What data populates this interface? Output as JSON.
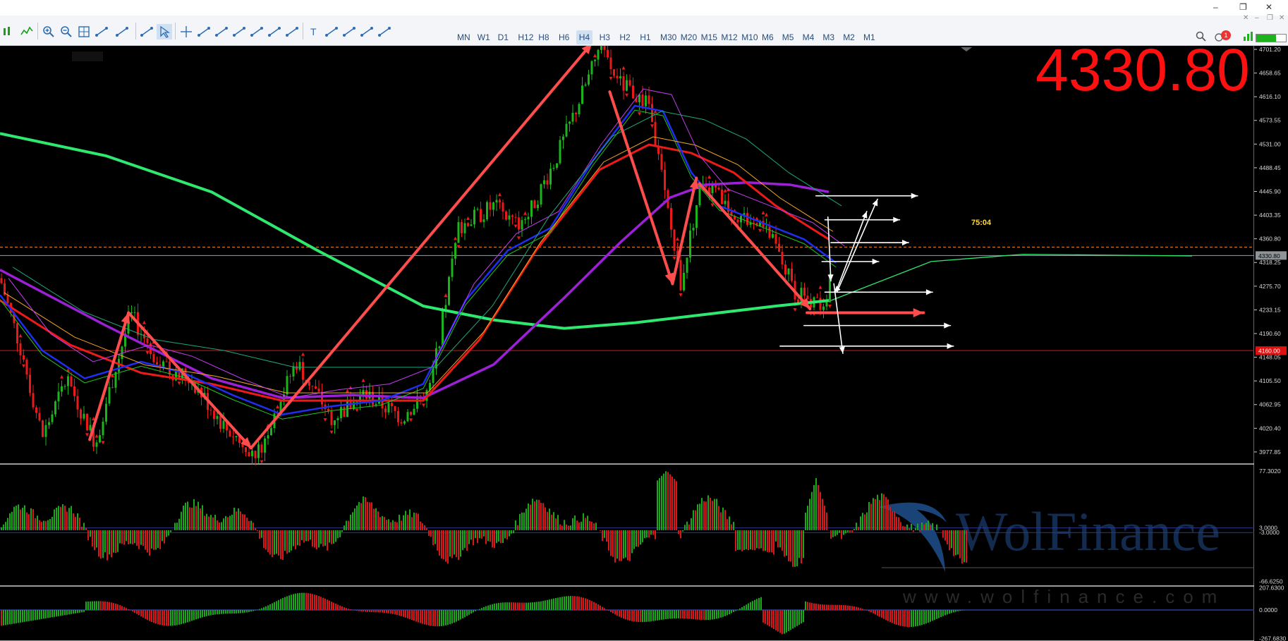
{
  "window": {
    "controls": [
      "–",
      "❐",
      "✕"
    ],
    "sub_controls": [
      "✕",
      "–",
      "❐",
      "✕"
    ]
  },
  "toolbar": {
    "timeframes": [
      "MN",
      "W1",
      "D1",
      "H12",
      "H8",
      "H6",
      "H4",
      "H3",
      "H2",
      "H1",
      "M30",
      "M20",
      "M15",
      "M12",
      "M10",
      "M6",
      "M5",
      "M4",
      "M3",
      "M2",
      "M1"
    ],
    "active_timeframe": "H4",
    "left_tools": [
      "bar-chart-icon",
      "line-chart-icon",
      "zoom-in-icon",
      "zoom-out-icon",
      "grid-icon",
      "autoscroll-icon",
      "chart-shift-icon",
      "screenshot-icon",
      "cursor-icon",
      "crosshair-icon",
      "vertical-line-icon",
      "horizontal-line-icon",
      "trendline-icon",
      "ray-icon",
      "channel-icon",
      "fibonacci-icon",
      "text-icon",
      "elliott-icon",
      "gann-icon",
      "shapes-icon",
      "more-shapes-icon"
    ],
    "right_tools": [
      "search-icon",
      "notifications-icon",
      "signal-icon"
    ],
    "notification_count": "1"
  },
  "colors": {
    "bull": "#1db31d",
    "bear": "#e81a1a",
    "ma_fast_blue": "#1f2ef0",
    "ma_red": "#ee1a1a",
    "ma_purple": "#9b20d6",
    "ma_green": "#2ee86f",
    "ma_orange": "#f5a623",
    "hist_bull": "#18a818",
    "hist_bear": "#d71818",
    "annotation": "#ff4d4d",
    "big_price": "#ff1010"
  },
  "price_display": "4330.80",
  "countdown": "75:04",
  "watermark": {
    "brand": "WolFinance",
    "url": "www.wolfinance.com"
  },
  "chart_data": [
    {
      "type": "candlestick",
      "title": "",
      "y_axis_ticks": [
        "4701.20",
        "4658.65",
        "4616.10",
        "4573.55",
        "4531.00",
        "4488.45",
        "4445.90",
        "4403.35",
        "4360.80",
        "4318.25",
        "4275.70",
        "4233.15",
        "4190.60",
        "4148.05",
        "4105.50",
        "4062.95",
        "4020.40",
        "3977.85"
      ],
      "ylim": [
        3960,
        4705
      ],
      "current_price_label": "4330.80",
      "support_level_label": "4160.00",
      "dashed_reference": 4346,
      "price_path_pivots": [
        {
          "x": 0,
          "y": 4290
        },
        {
          "x": 30,
          "y": 4160
        },
        {
          "x": 60,
          "y": 4005
        },
        {
          "x": 95,
          "y": 4110
        },
        {
          "x": 135,
          "y": 3995
        },
        {
          "x": 185,
          "y": 4225
        },
        {
          "x": 230,
          "y": 4130
        },
        {
          "x": 270,
          "y": 4110
        },
        {
          "x": 320,
          "y": 4020
        },
        {
          "x": 365,
          "y": 3975
        },
        {
          "x": 420,
          "y": 4140
        },
        {
          "x": 470,
          "y": 4040
        },
        {
          "x": 520,
          "y": 4080
        },
        {
          "x": 570,
          "y": 4040
        },
        {
          "x": 610,
          "y": 4090
        },
        {
          "x": 650,
          "y": 4380
        },
        {
          "x": 700,
          "y": 4420
        },
        {
          "x": 740,
          "y": 4380
        },
        {
          "x": 790,
          "y": 4510
        },
        {
          "x": 850,
          "y": 4700
        },
        {
          "x": 880,
          "y": 4640
        },
        {
          "x": 920,
          "y": 4600
        },
        {
          "x": 965,
          "y": 4280
        },
        {
          "x": 995,
          "y": 4470
        },
        {
          "x": 1040,
          "y": 4410
        },
        {
          "x": 1090,
          "y": 4370
        },
        {
          "x": 1130,
          "y": 4260
        },
        {
          "x": 1170,
          "y": 4235
        },
        {
          "x": 1178,
          "y": 4330
        }
      ],
      "moving_averages": [
        {
          "name": "",
          "color": "ma_green",
          "width": 4,
          "points": [
            [
              0,
              4550
            ],
            [
              150,
              4510
            ],
            [
              300,
              4445
            ],
            [
              450,
              4340
            ],
            [
              600,
              4240
            ],
            [
              700,
              4215
            ],
            [
              800,
              4200
            ],
            [
              900,
              4210
            ],
            [
              1000,
              4225
            ],
            [
              1100,
              4240
            ],
            [
              1175,
              4250
            ]
          ]
        },
        {
          "name": "",
          "color": "ma_purple",
          "width": 3.5,
          "points": [
            [
              0,
              4305
            ],
            [
              150,
              4205
            ],
            [
              300,
              4110
            ],
            [
              400,
              4075
            ],
            [
              500,
              4080
            ],
            [
              600,
              4075
            ],
            [
              700,
              4135
            ],
            [
              800,
              4255
            ],
            [
              880,
              4355
            ],
            [
              950,
              4435
            ],
            [
              1000,
              4458
            ],
            [
              1060,
              4462
            ],
            [
              1120,
              4458
            ],
            [
              1175,
              4445
            ]
          ]
        },
        {
          "name": "",
          "color": "ma_red",
          "width": 3,
          "points": [
            [
              0,
              4250
            ],
            [
              100,
              4170
            ],
            [
              200,
              4120
            ],
            [
              300,
              4100
            ],
            [
              400,
              4070
            ],
            [
              500,
              4070
            ],
            [
              600,
              4070
            ],
            [
              680,
              4180
            ],
            [
              760,
              4340
            ],
            [
              850,
              4485
            ],
            [
              920,
              4530
            ],
            [
              980,
              4515
            ],
            [
              1040,
              4480
            ],
            [
              1100,
              4420
            ],
            [
              1175,
              4360
            ]
          ]
        },
        {
          "name": "",
          "color": "ma_fast_blue",
          "width": 2.5,
          "points": [
            [
              0,
              4260
            ],
            [
              60,
              4160
            ],
            [
              120,
              4110
            ],
            [
              200,
              4140
            ],
            [
              260,
              4120
            ],
            [
              330,
              4080
            ],
            [
              400,
              4045
            ],
            [
              470,
              4060
            ],
            [
              540,
              4070
            ],
            [
              600,
              4100
            ],
            [
              660,
              4250
            ],
            [
              720,
              4340
            ],
            [
              780,
              4380
            ],
            [
              840,
              4500
            ],
            [
              900,
              4600
            ],
            [
              940,
              4590
            ],
            [
              980,
              4480
            ],
            [
              1020,
              4420
            ],
            [
              1080,
              4390
            ],
            [
              1140,
              4360
            ],
            [
              1185,
              4318
            ]
          ]
        }
      ],
      "annotations_arrows": [
        {
          "from": [
            150,
            4000
          ],
          "to": [
            215,
            4228
          ],
          "color": "annotation"
        },
        {
          "from": [
            215,
            4228
          ],
          "to": [
            420,
            3985
          ],
          "color": "annotation"
        },
        {
          "from": [
            420,
            3985
          ],
          "to": [
            990,
            4712
          ],
          "color": "annotation"
        },
        {
          "from": [
            1020,
            4625
          ],
          "to": [
            1125,
            4280
          ],
          "color": "annotation"
        },
        {
          "from": [
            1125,
            4280
          ],
          "to": [
            1165,
            4470
          ],
          "color": "annotation"
        },
        {
          "from": [
            1170,
            4460
          ],
          "to": [
            1355,
            4235
          ],
          "color": "annotation"
        },
        {
          "from": [
            1350,
            4228
          ],
          "to": [
            1545,
            4228
          ],
          "color": "annotation"
        }
      ],
      "projection_arrows": [
        {
          "from": [
            1365,
            4438
          ],
          "to": [
            1535,
            4438
          ]
        },
        {
          "from": [
            1380,
            4395
          ],
          "to": [
            1505,
            4395
          ]
        },
        {
          "from": [
            1390,
            4354
          ],
          "to": [
            1520,
            4354
          ]
        },
        {
          "from": [
            1375,
            4320
          ],
          "to": [
            1470,
            4320
          ]
        },
        {
          "from": [
            1380,
            4265
          ],
          "to": [
            1560,
            4265
          ]
        },
        {
          "from": [
            1345,
            4205
          ],
          "to": [
            1590,
            4205
          ]
        },
        {
          "from": [
            1305,
            4168
          ],
          "to": [
            1595,
            4168
          ]
        },
        {
          "from": [
            1400,
            4270
          ],
          "to": [
            1450,
            4410
          ]
        },
        {
          "from": [
            1400,
            4270
          ],
          "to": [
            1395,
            4265
          ]
        },
        {
          "from": [
            1400,
            4265
          ],
          "to": [
            1468,
            4432
          ]
        },
        {
          "from": [
            1385,
            4400
          ],
          "to": [
            1390,
            4285
          ]
        },
        {
          "from": [
            1395,
            4280
          ],
          "to": [
            1410,
            4155
          ]
        }
      ]
    },
    {
      "type": "histogram",
      "title": "",
      "y_axis_ticks": [
        "77.3020",
        "3.0000",
        "-3.0000",
        "-66.6250"
      ],
      "ylim": [
        -70,
        80
      ]
    },
    {
      "type": "histogram",
      "title": "",
      "y_axis_ticks": [
        "207.6300",
        "0.0000",
        "-267.6830"
      ],
      "ylim": [
        -270,
        210
      ]
    }
  ]
}
